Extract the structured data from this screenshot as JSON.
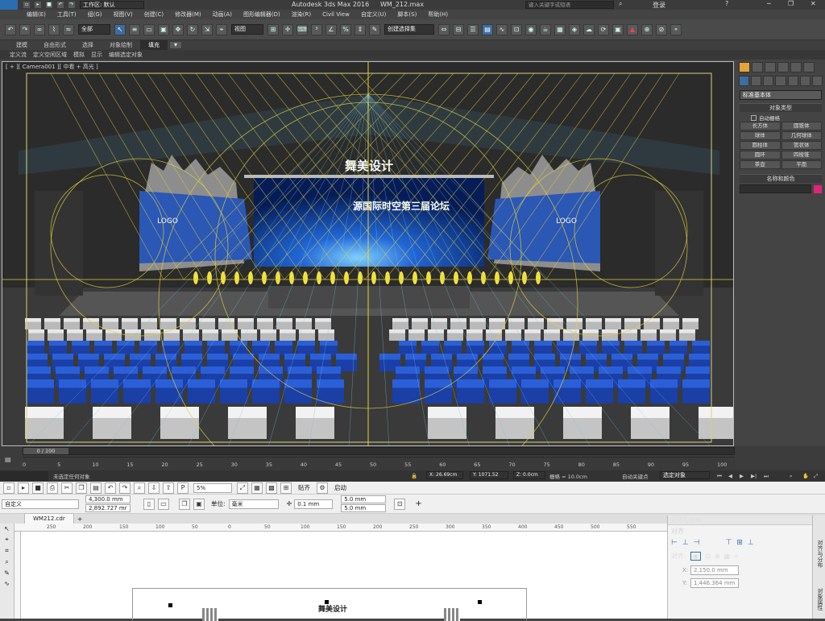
{
  "max": {
    "app_logo": "MAX",
    "title": "Autodesk 3ds Max 2016",
    "file": "WM_212.max",
    "workspace_label": "工作区: 默认",
    "search_placeholder": "键入关键字或短语",
    "login_label": "登录",
    "menu": [
      "编辑(E)",
      "工具(T)",
      "组(G)",
      "视图(V)",
      "创建(C)",
      "修改器(M)",
      "动画(A)",
      "图形编辑器(D)",
      "渲染(R)",
      "Civil View",
      "自定义(U)",
      "脚本(S)",
      "帮助(H)"
    ],
    "selection_filter": "全部",
    "ref_coord": "视图",
    "named_selection": "创建选择集",
    "ribbon_tabs": [
      "建模",
      "自由形式",
      "选择",
      "对象绘制",
      "填充"
    ],
    "ribbon_sub": [
      "定义流",
      "定义空闲区域",
      "模拟",
      "显示",
      "编辑选定对象"
    ],
    "viewport_label": "[ + ][ Camera001 ][ 中看 + 高光 ]",
    "stage_title": "舞美设计",
    "screen_text": "源国际时空第三届论坛",
    "logo_text": "LOGO",
    "cmd_section_types": "对象类型",
    "cmd_dropdown": "标准基本体",
    "autogrid": "自动栅格",
    "primitives": [
      "长方体",
      "圆锥体",
      "球体",
      "几何球体",
      "圆柱体",
      "管状体",
      "圆环",
      "四棱锥",
      "茶壶",
      "平面"
    ],
    "cmd_section_name": "名称和颜色",
    "frame_counter": "0 / 100",
    "ticks": [
      "0",
      "5",
      "10",
      "15",
      "20",
      "25",
      "30",
      "35",
      "40",
      "45",
      "50",
      "55",
      "60",
      "65",
      "70",
      "75",
      "80",
      "85",
      "90",
      "95",
      "100"
    ],
    "status_text": "未选定任何对象",
    "coord_x": "X: 26.69cm",
    "coord_y": "Y: 1071.52",
    "coord_z": "Z: 0.0cm",
    "grid_label": "栅格 = 10.0cm",
    "autokey_label": "自动关键点",
    "selected_label": "选定对象",
    "accent_color": "#e0247a"
  },
  "cdr": {
    "zoom": "5%",
    "snap_label": "贴齐",
    "launch_label": "启动",
    "preset": "自定义",
    "width": "4,300.0 mm",
    "height": "2,892.727 mr",
    "units_label": "单位:",
    "units_value": "毫米",
    "nudge": "0.1 mm",
    "dup_x": "5.0 mm",
    "dup_y": "5.0 mm",
    "doc_tab": "WM212.cdr",
    "page_title": "舞美设计",
    "ruler": [
      "250",
      "200",
      "150",
      "100",
      "50",
      "0",
      "50",
      "100",
      "150",
      "200",
      "250",
      "300",
      "350",
      "400",
      "450",
      "500",
      "550"
    ],
    "dock_title": "对齐与分布",
    "dock_section": "对齐",
    "align_to_label": "对齐:",
    "pos_x": "2,150.0 mm",
    "pos_y": "1,446.364 mm",
    "strip_tabs": [
      "对齐与分布",
      "对象属性"
    ]
  }
}
